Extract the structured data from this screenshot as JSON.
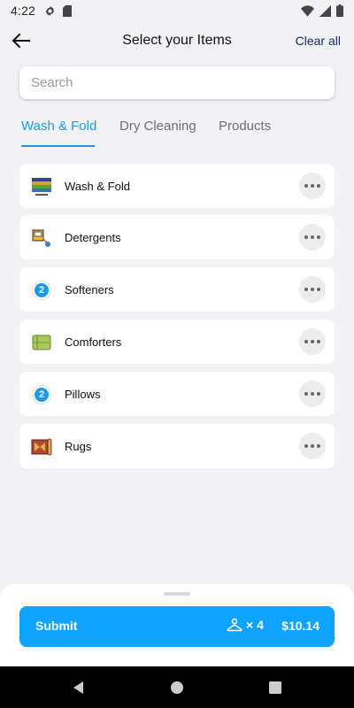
{
  "status_bar": {
    "time": "4:22"
  },
  "header": {
    "title": "Select your Items",
    "clear_all": "Clear all"
  },
  "search": {
    "placeholder": "Search",
    "value": ""
  },
  "tabs": [
    {
      "label": "Wash & Fold",
      "active": true
    },
    {
      "label": "Dry Cleaning",
      "active": false
    },
    {
      "label": "Products",
      "active": false
    }
  ],
  "items": [
    {
      "label": "Wash & Fold",
      "icon": "folded-clothes-icon"
    },
    {
      "label": "Detergents",
      "icon": "detergent-icon"
    },
    {
      "label": "Softeners",
      "icon": "softener-badge-icon",
      "badge": "2"
    },
    {
      "label": "Comforters",
      "icon": "comforter-icon"
    },
    {
      "label": "Pillows",
      "icon": "pillow-badge-icon",
      "badge": "2"
    },
    {
      "label": "Rugs",
      "icon": "rug-icon"
    }
  ],
  "footer": {
    "submit_label": "Submit",
    "count": "× 4",
    "price": "$10.14"
  },
  "colors": {
    "accent": "#1a9be8",
    "submit_bg": "#0ea3ff",
    "background": "#f2f2f4"
  }
}
